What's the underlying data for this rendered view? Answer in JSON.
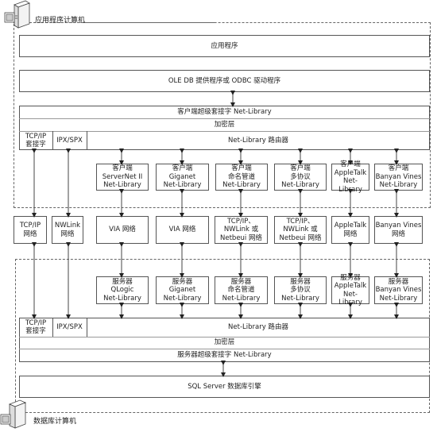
{
  "client_machine": {
    "label": "应用程序计算机",
    "icon": "computer-icon"
  },
  "server_machine": {
    "label": "数据库计算机",
    "icon": "computer-icon"
  },
  "client": {
    "application": "应用程序",
    "provider": "OLE DB 提供程序或 ODBC 驱动程序",
    "super_socket": "客户端超级套接字 Net-Library",
    "encryption": "加密层",
    "tcpip_socket": "TCP/IP\n套接字",
    "ipxspx": "IPX/SPX",
    "router": "Net-Library 路由器",
    "netlibs": [
      "客户端\nServerNet II\nNet-Library",
      "客户端\nGiganet\nNet-Library",
      "客户端\n命名管道\nNet-Library",
      "客户端\n多协议\nNet-Library",
      "客户端\nAppleTalk\nNet-Library",
      "客户端\nBanyan Vines\nNet-Library"
    ]
  },
  "networks": [
    "TCP/IP\n网络",
    "NWLink\n网络",
    "VIA 网络",
    "VIA 网络",
    "TCP/IP、\nNWLink 或\nNetbeui 网络",
    "TCP/IP、\nNWLink 或\nNetbeui 网络",
    "AppleTalk\n网络",
    "Banyan Vines\n网络"
  ],
  "server": {
    "netlibs": [
      "服务器\nQLogic\nNet-Library",
      "服务器\nGiganet\nNet-Library",
      "服务器\n命名管道\nNet-Library",
      "服务器\n多协议\nNet-Library",
      "服务器\nAppleTalk\nNet-Library",
      "服务器\nBanyan Vines\nNet-Library"
    ],
    "tcpip_socket": "TCP/IP\n套接字",
    "ipxspx": "IPX/SPX",
    "router": "Net-Library 路由器",
    "encryption": "加密层",
    "super_socket": "服务器超级套接字 Net-Library",
    "engine": "SQL Server 数据库引擎"
  }
}
